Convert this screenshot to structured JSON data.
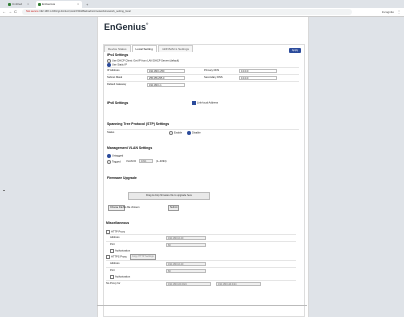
{
  "browser": {
    "tabs": [
      {
        "title": "Untitled"
      },
      {
        "title": "EnGenius"
      }
    ],
    "new_tab": "+",
    "back": "←",
    "forward": "→",
    "reload": "C",
    "security_warning": "Not secure",
    "url": "192.168.1.230/cgi-bin/luci/;stok=f3b3d8a1/admin/network/network_setting_local",
    "profile": "Incognito",
    "menu": "⋮"
  },
  "header": {
    "logo": "EnGenius",
    "logo_mark": "®"
  },
  "tabs": [
    "Device Status",
    "Local Setting",
    "mDNS/ACL Settings"
  ],
  "apply_label": "Apply",
  "ipv4": {
    "title": "IPv4 Settings",
    "dhcp_label": "Use DHCP Client: Get IP from LAN DHCP Server (default)",
    "static_label": "Use Static IP",
    "ip_label": "IP Address",
    "ip_value": "192.168.1.250",
    "primary_dns_label": "Primary DNS",
    "primary_dns_value": "0.0.0.0",
    "subnet_label": "Subnet Mask",
    "subnet_value": "255.255.255.0",
    "secondary_dns_label": "Secondary DNS",
    "secondary_dns_value": "0.0.0.0",
    "gateway_label": "Default Gateway",
    "gateway_value": "192.168.1.1"
  },
  "ipv6": {
    "title": "IPv6 Settings",
    "link_local_label": "Link-local Address"
  },
  "stp": {
    "title": "Spanning Tree Protocol (STP) Settings",
    "status_label": "Status",
    "enable_label": "Enable",
    "disable_label": "Disable"
  },
  "vlan": {
    "title": "Management VLAN Settings",
    "untagged_label": "Untagged",
    "tagged_label": "Tagged",
    "vlan_id_label": "VLAN ID",
    "vlan_id_value": "4094",
    "vlan_range": "(1~4094)"
  },
  "firmware": {
    "title": "Firmware Upgrade",
    "drop_label": "Drag & drop firmware file to upgrade here",
    "choose_label": "Choose File",
    "no_file_label": "No file chosen",
    "submit_label": "Submit"
  },
  "misc": {
    "title": "Miscellaneous",
    "http_proxy_label": "HTTP Proxy",
    "address_label": "Address",
    "http_address_value": "192.168.10.20",
    "port_label": "Port",
    "http_port_value": "80",
    "auth_label": "Authorization",
    "https_proxy_label": "HTTPS Proxy",
    "copy_http_label": "Copy HTTP Settings",
    "https_address_value": "192.168.10.20",
    "https_port_value": "80",
    "no_proxy_label": "No Proxy for",
    "no_proxy_value_1": "192.168.100.0/24",
    "no_proxy_value_2": "192.168.110.0/24"
  }
}
